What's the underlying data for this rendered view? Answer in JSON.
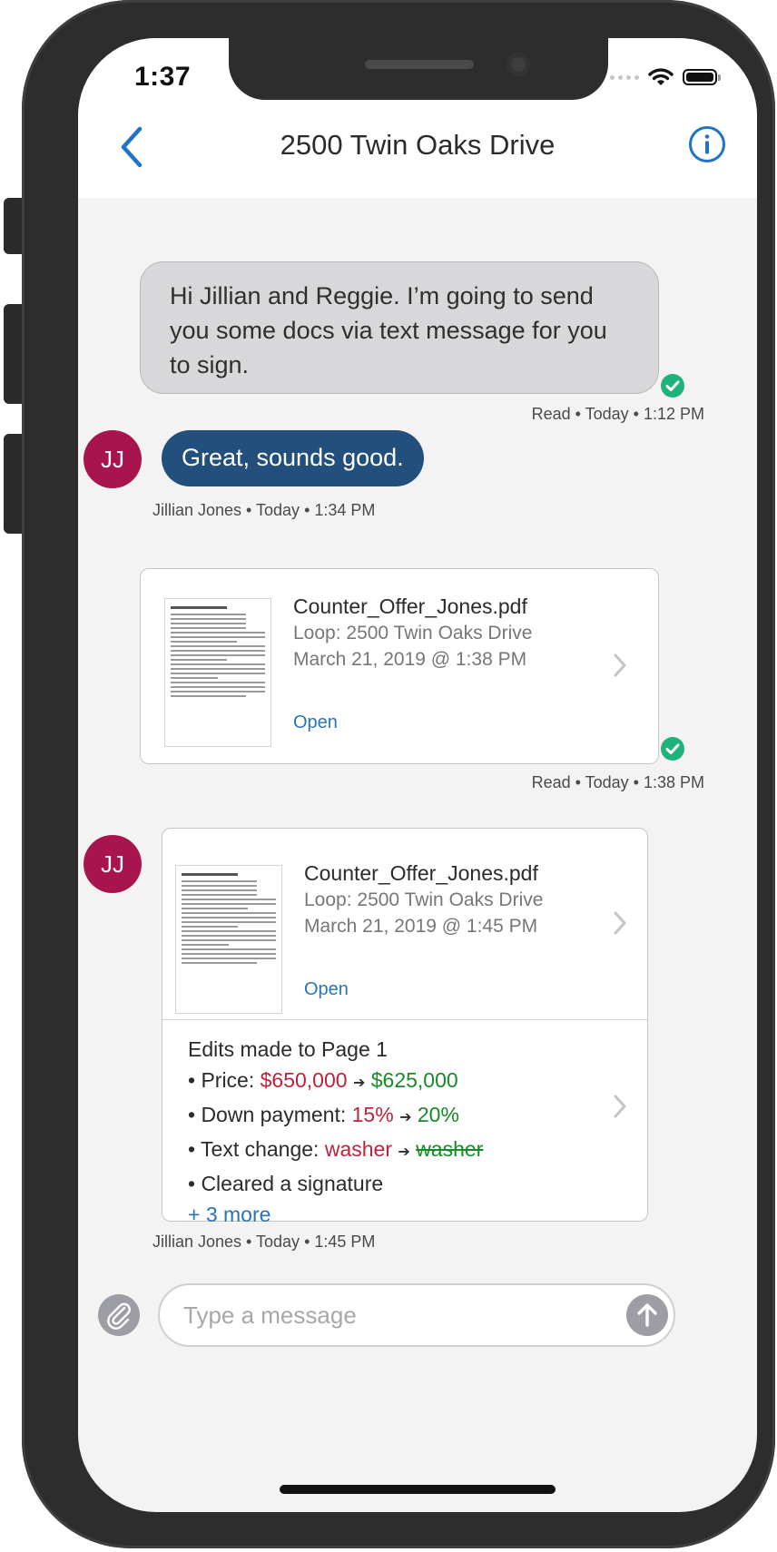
{
  "status_bar": {
    "time": "1:37"
  },
  "header": {
    "title": "2500 Twin Oaks Drive"
  },
  "messages": {
    "m1": {
      "text": "Hi Jillian and Reggie. I’m going to send you some docs via text message for you to sign.",
      "meta": "Read • Today • 1:12 PM"
    },
    "m2": {
      "avatar": "JJ",
      "text": "Great, sounds good.",
      "meta": "Jillian Jones • Today • 1:34 PM"
    },
    "m3": {
      "file_name": "Counter_Offer_Jones.pdf",
      "loop": "Loop: 2500 Twin Oaks Drive",
      "date": "March 21, 2019 @ 1:38 PM",
      "open_label": "Open",
      "meta": "Read • Today • 1:38 PM"
    },
    "m4": {
      "avatar": "JJ",
      "file_name": "Counter_Offer_Jones.pdf",
      "loop": "Loop: 2500 Twin Oaks Drive",
      "date": "March 21, 2019 @ 1:45 PM",
      "open_label": "Open",
      "edits_title": "Edits made to Page 1",
      "edit_price_label": "• Price: ",
      "edit_price_old": "$650,000",
      "edit_price_new": "$625,000",
      "edit_down_label": "• Down payment: ",
      "edit_down_old": "15%",
      "edit_down_new": "20%",
      "edit_text_label": "• Text change: ",
      "edit_text_old": "washer",
      "edit_text_new": "washer",
      "edit_signature": "• Cleared a signature",
      "more": "+ 3 more",
      "arrow": "➔",
      "meta": "Jillian Jones • Today • 1:45 PM"
    }
  },
  "composer": {
    "placeholder": "Type a message"
  },
  "colors": {
    "accent": "#2a74b5",
    "bubble_sent": "#d8d8da",
    "bubble_received": "#234f7c",
    "avatar": "#a8144d",
    "read_check": "#1fb27a"
  }
}
